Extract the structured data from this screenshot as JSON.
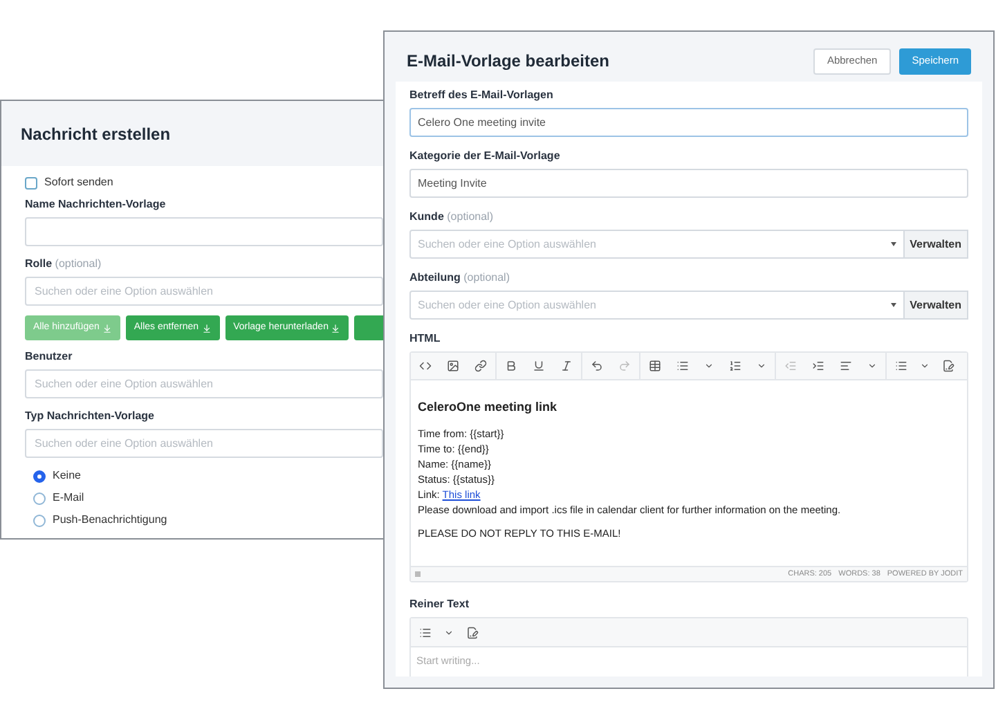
{
  "back_window": {
    "title": "Nachricht erstellen",
    "items": [
      {
        "kind": "checkbox",
        "label": "Sofort senden",
        "checked": false
      },
      {
        "kind": "field",
        "label": "Name Nachrichten-Vorlage"
      },
      {
        "kind": "field",
        "label": "Rolle",
        "hint": "(optional)",
        "placeholder": "Suchen oder eine Option auswählen"
      },
      {
        "kind": "button_row",
        "buttons": [
          {
            "label": "Alle hinzufügen",
            "disabled": true
          },
          {
            "label": "Alles entfernen",
            "disabled": false
          },
          {
            "label": "Vorlage herunterladen",
            "disabled": false
          }
        ]
      },
      {
        "kind": "field",
        "label": "Benutzer",
        "placeholder": "Suchen oder eine Option auswählen"
      },
      {
        "kind": "field",
        "label": "Typ Nachrichten-Vorlage",
        "placeholder": "Suchen oder eine Option auswählen"
      },
      {
        "kind": "radio_group",
        "options": [
          {
            "label": "Keine",
            "selected": true
          },
          {
            "label": "E-Mail",
            "selected": false
          },
          {
            "label": "Push-Benachrichtigung",
            "selected": false
          }
        ]
      }
    ]
  },
  "front_window": {
    "title": "E-Mail-Vorlage bearbeiten",
    "actions": [
      {
        "label": "Abbrechen",
        "kind": "secondary"
      },
      {
        "label": "Speichern",
        "kind": "primary"
      }
    ],
    "fields": [
      {
        "kind": "input",
        "label": "Betreff des E-Mail-Vorlagen",
        "value": "Celero One meeting invite",
        "focused": true
      },
      {
        "kind": "input",
        "label": "Kategorie der E-Mail-Vorlage",
        "value": "Meeting Invite",
        "focused": false
      },
      {
        "kind": "select",
        "label": "Kunde",
        "hint": "(optional)",
        "placeholder": "Suchen oder eine Option auswählen",
        "action": "Verwalten"
      },
      {
        "kind": "select",
        "label": "Abteilung",
        "hint": "(optional)",
        "placeholder": "Suchen oder eine Option auswählen",
        "action": "Verwalten"
      }
    ],
    "html_editor": {
      "label": "HTML",
      "heading": "CeleroOne meeting link",
      "lines": [
        {
          "text": "Time from: {{start}}"
        },
        {
          "text": "Time to: {{end}}"
        },
        {
          "text": "Name: {{name}}"
        },
        {
          "text": "Status: {{status}}"
        },
        {
          "text": "Link: ",
          "link": "This link"
        },
        {
          "text": "Please download and import .ics file in calendar client for further information on the meeting."
        }
      ],
      "footer": "PLEASE DO NOT REPLY TO THIS E-MAIL!",
      "status_items": [
        "CHARS: 205",
        "WORDS: 38",
        "POWERED BY JODIT"
      ]
    },
    "text_editor": {
      "label": "Reiner Text",
      "placeholder": "Start writing..."
    }
  }
}
